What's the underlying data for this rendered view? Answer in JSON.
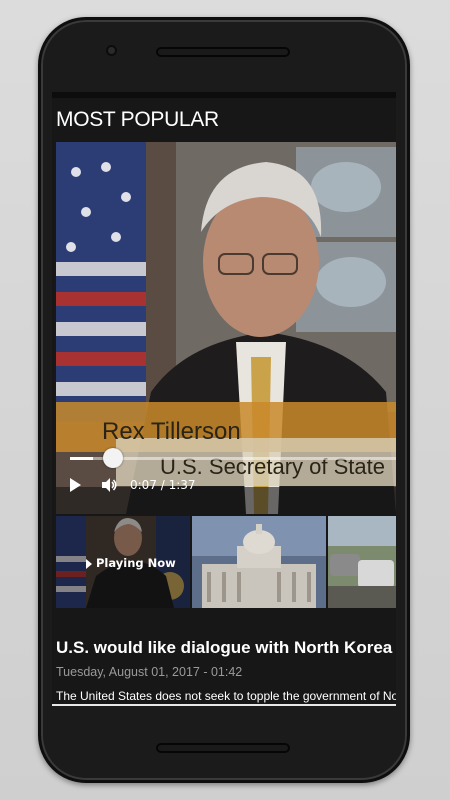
{
  "section": {
    "title": "MOST POPULAR"
  },
  "video": {
    "caption_name": "Rex Tillerson",
    "caption_role": "U.S. Secretary of State",
    "time_readout": "0:07 / 1:37",
    "progress": 0.07
  },
  "playlist": [
    {
      "label": "Playing Now",
      "active": true
    },
    {
      "label": "",
      "active": false
    },
    {
      "label": "",
      "active": false
    }
  ],
  "article": {
    "headline": "U.S. would like dialogue with North Korea at some point",
    "date": "Tuesday, August 01, 2017 - 01:42",
    "summary": "The United States does not seek to topple the government of North Korea"
  },
  "icons": {
    "play": "play-icon",
    "volume": "volume-icon",
    "playing_indicator": "play-arrow-icon"
  },
  "colors": {
    "screen_bg": "#171717",
    "caption_band": "#c98a2a",
    "text_primary": "#ffffff",
    "text_secondary": "#9a9a9a"
  }
}
